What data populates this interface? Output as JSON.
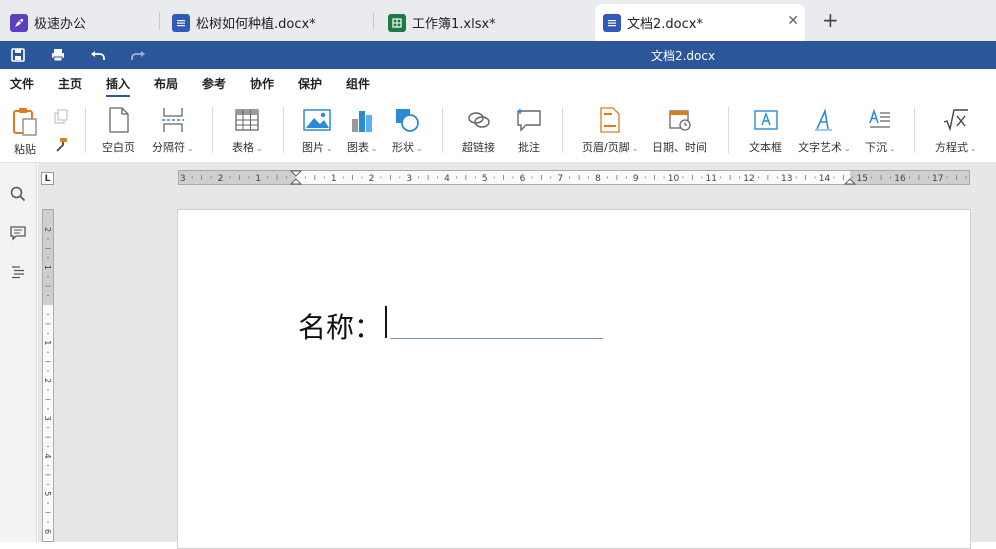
{
  "tabs": [
    {
      "label": "极速办公",
      "icon": "rocket-icon",
      "color": "#5b3fbf"
    },
    {
      "label": "松树如何种植.docx*",
      "icon": "word-doc-icon",
      "color": "#2f5bb7"
    },
    {
      "label": "工作簿1.xlsx*",
      "icon": "excel-doc-icon",
      "color": "#1d7a43"
    },
    {
      "label": "文档2.docx*",
      "icon": "word-doc-icon",
      "color": "#2f5bb7"
    }
  ],
  "close_glyph": "✕",
  "new_tab_glyph": "+",
  "title": "文档2.docx",
  "menu": [
    "文件",
    "主页",
    "插入",
    "布局",
    "参考",
    "协作",
    "保护",
    "组件"
  ],
  "active_menu": "插入",
  "ribbon": {
    "paste": "粘贴",
    "blank_page": "空白页",
    "separator": "分隔符",
    "table": "表格",
    "picture": "图片",
    "chart": "图表",
    "shape": "形状",
    "hyperlink": "超链接",
    "comment": "批注",
    "header_footer": "页眉/页脚",
    "date_time": "日期、时间",
    "text_box": "文本框",
    "word_art": "文字艺术",
    "drop_cap": "下沉",
    "equation": "方程式"
  },
  "ruler_corner": "L",
  "hruler_labels": [
    "3",
    "2",
    "1",
    "",
    "1",
    "2",
    "3",
    "4",
    "5",
    "6",
    "7",
    "8",
    "9",
    "10",
    "11",
    "12",
    "13",
    "14",
    "",
    "15",
    "16",
    "17"
  ],
  "vruler_labels": [
    "2",
    "1",
    "",
    "1",
    "2",
    "3",
    "4",
    "5",
    "6"
  ],
  "document": {
    "field_label": "名称："
  },
  "colors": {
    "accent": "#2b579a",
    "tabbar": "#e9ebef",
    "canvas": "#e7e7e7"
  }
}
